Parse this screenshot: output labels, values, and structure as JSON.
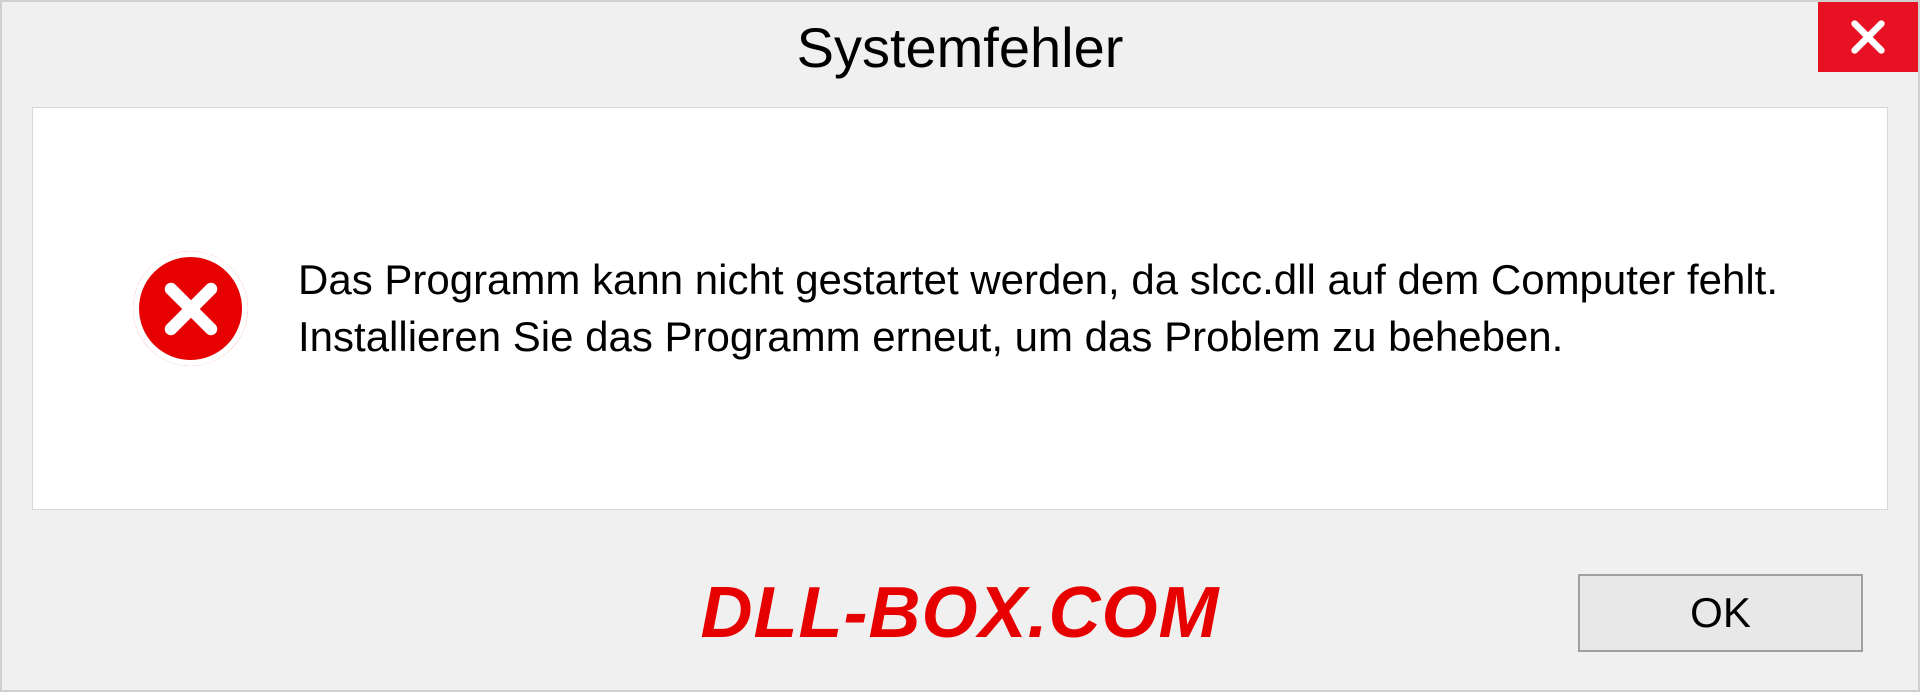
{
  "dialog": {
    "title": "Systemfehler",
    "message": "Das Programm kann nicht gestartet werden, da slcc.dll auf dem Computer fehlt. Installieren Sie das Programm erneut, um das Problem zu beheben.",
    "ok_label": "OK",
    "watermark": "DLL-BOX.COM"
  }
}
